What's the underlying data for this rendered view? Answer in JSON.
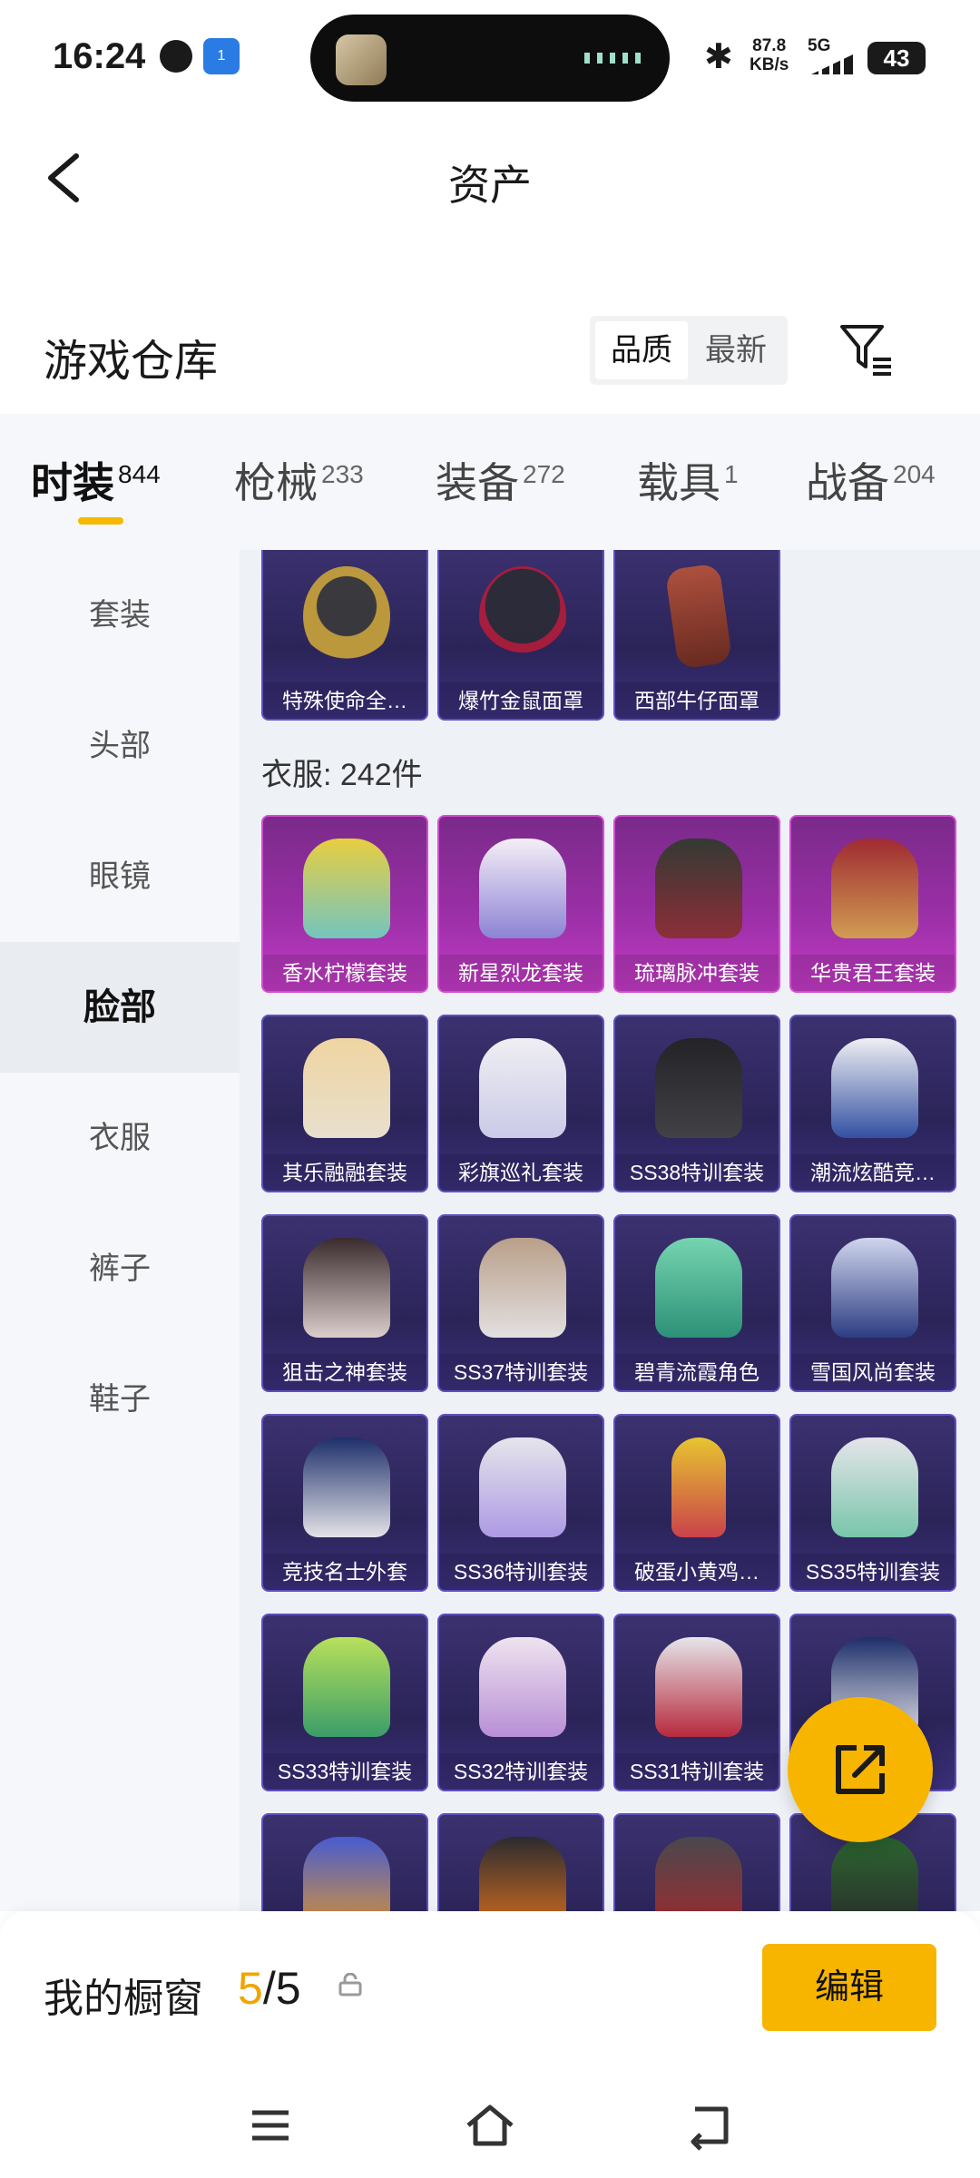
{
  "status_bar": {
    "time": "16:24",
    "nfc_badge": "1",
    "net_speed_value": "87.8",
    "net_speed_unit": "KB/s",
    "signal": "5G",
    "battery": "43"
  },
  "header": {
    "title": "资产"
  },
  "warehouse": {
    "title": "游戏仓库",
    "sort_options": [
      "品质",
      "最新"
    ]
  },
  "tabs": [
    {
      "label": "时装",
      "count": "844",
      "active": true
    },
    {
      "label": "枪械",
      "count": "233"
    },
    {
      "label": "装备",
      "count": "272"
    },
    {
      "label": "载具",
      "count": "1"
    },
    {
      "label": "战备",
      "count": "204"
    }
  ],
  "sidebar": [
    {
      "label": "套装"
    },
    {
      "label": "头部"
    },
    {
      "label": "眼镜"
    },
    {
      "label": "脸部",
      "active": true
    },
    {
      "label": "衣服"
    },
    {
      "label": "裤子"
    },
    {
      "label": "鞋子"
    }
  ],
  "face_items": [
    {
      "name": "特殊使命全…",
      "art": "helmet"
    },
    {
      "name": "爆竹金鼠面罩",
      "art": "mask"
    },
    {
      "name": "西部牛仔面罩",
      "art": "cloth"
    }
  ],
  "clothes": {
    "label": "衣服: 242件",
    "items": [
      {
        "name": "香水柠檬套装",
        "art": "yellow",
        "rarity": "purple"
      },
      {
        "name": "新星烈龙套装",
        "art": "white",
        "rarity": "purple"
      },
      {
        "name": "琉璃脉冲套装",
        "art": "green",
        "rarity": "purple"
      },
      {
        "name": "华贵君王套装",
        "art": "gold",
        "rarity": "purple"
      },
      {
        "name": "其乐融融套装",
        "art": "cream"
      },
      {
        "name": "彩旗巡礼套装",
        "art": "lace"
      },
      {
        "name": "SS38特训套装",
        "art": "black"
      },
      {
        "name": "潮流炫酷竞…",
        "art": "jacket"
      },
      {
        "name": "狙击之神套装",
        "art": "dark"
      },
      {
        "name": "SS37特训套装",
        "art": "beige"
      },
      {
        "name": "碧青流霞角色",
        "art": "mint"
      },
      {
        "name": "雪国风尚套装",
        "art": "navy"
      },
      {
        "name": "竞技名士外套",
        "art": "silver"
      },
      {
        "name": "SS36特训套装",
        "art": "lilac"
      },
      {
        "name": "破蛋小黄鸡…",
        "art": "chick"
      },
      {
        "name": "SS35特训套装",
        "art": "mint2"
      },
      {
        "name": "SS33特训套装",
        "art": "lime"
      },
      {
        "name": "SS32特训套装",
        "art": "pink"
      },
      {
        "name": "SS31特训套装",
        "art": "redwhite"
      },
      {
        "name": "",
        "art": "silver"
      },
      {
        "name": "",
        "art": "blueorange"
      },
      {
        "name": "",
        "art": "orangeblack"
      },
      {
        "name": "",
        "art": "grayred"
      },
      {
        "name": "",
        "art": "greenblack"
      }
    ]
  },
  "showcase": {
    "label": "我的橱窗",
    "current": "5",
    "total": "/5",
    "edit_label": "编辑"
  },
  "colors": {
    "accent": "#f7b500",
    "rare_purple": "#c23bc4",
    "card_blue": "#2b2458"
  }
}
